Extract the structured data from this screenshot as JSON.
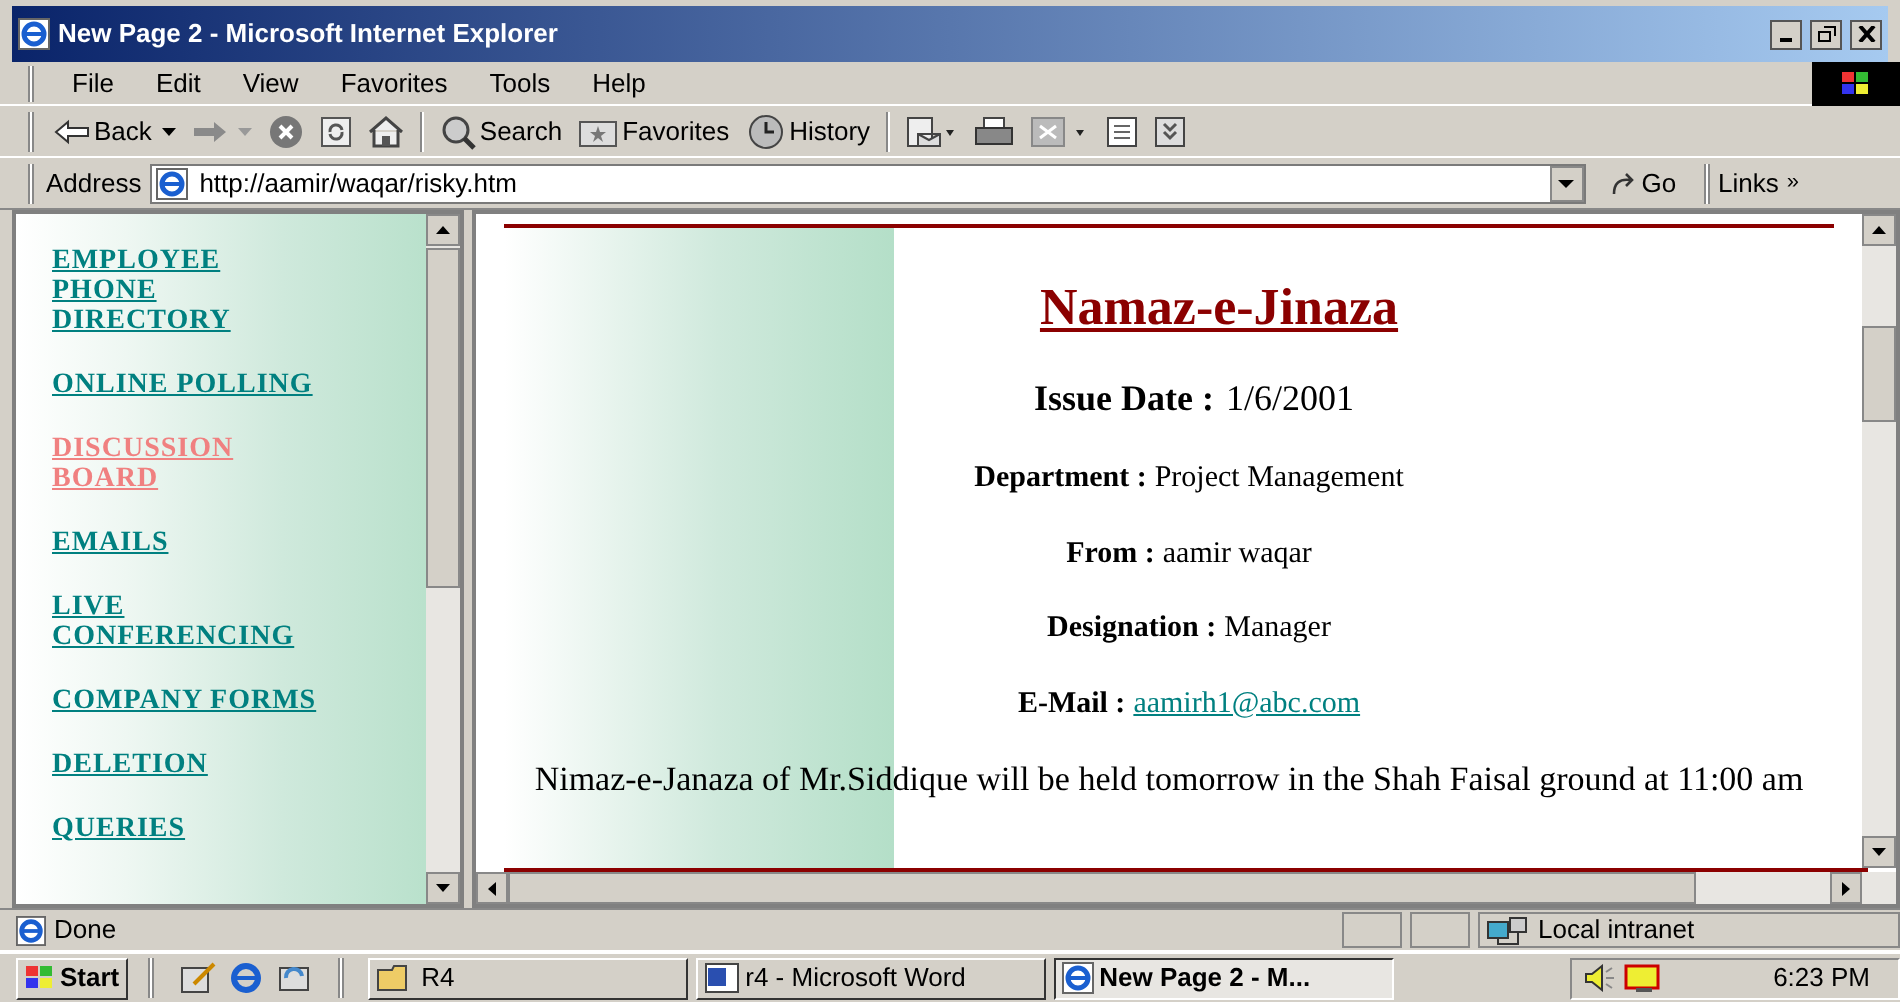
{
  "window": {
    "title": "New Page 2 - Microsoft Internet Explorer"
  },
  "menu": [
    "File",
    "Edit",
    "View",
    "Favorites",
    "Tools",
    "Help"
  ],
  "toolbar": [
    {
      "kind": "back",
      "label": "Back"
    },
    {
      "kind": "forward"
    },
    {
      "kind": "stop"
    },
    {
      "kind": "refresh"
    },
    {
      "kind": "home"
    },
    {
      "kind": "search",
      "label": "Search"
    },
    {
      "kind": "favorites",
      "label": "Favorites"
    },
    {
      "kind": "history",
      "label": "History"
    },
    {
      "kind": "mail"
    },
    {
      "kind": "print"
    },
    {
      "kind": "edit"
    },
    {
      "kind": "discuss"
    },
    {
      "kind": "messenger"
    }
  ],
  "address": {
    "label": "Address",
    "url": "http://aamir/waqar/risky.htm",
    "go": "Go",
    "links": "Links",
    "more": "»"
  },
  "sidebar": {
    "items": [
      {
        "lines": [
          "EMPLOYEE",
          "PHONE",
          "DIRECTORY"
        ],
        "visited": false
      },
      {
        "lines": [
          "ONLINE POLLING"
        ],
        "visited": false
      },
      {
        "lines": [
          "DISCUSSION",
          "BOARD"
        ],
        "visited": true
      },
      {
        "lines": [
          "EMAILS"
        ],
        "visited": false
      },
      {
        "lines": [
          "LIVE",
          "CONFERENCING"
        ],
        "visited": false
      },
      {
        "lines": [
          "COMPANY FORMS"
        ],
        "visited": false
      },
      {
        "lines": [
          "DELETION"
        ],
        "visited": false
      },
      {
        "lines": [
          "QUERIES"
        ],
        "visited": false
      }
    ]
  },
  "notice": {
    "heading": "Namaz-e-Jinaza",
    "issue_label": "Issue Date :",
    "issue_date": "1/6/2001",
    "fields": [
      {
        "label": "Department :",
        "value": "Project Management",
        "kind": "text"
      },
      {
        "label": "From :",
        "value": "aamir waqar",
        "kind": "text"
      },
      {
        "label": "Designation :",
        "value": "Manager",
        "kind": "text"
      },
      {
        "label": "E-Mail :",
        "value": "aamirh1@abc.com",
        "kind": "link"
      }
    ],
    "message": "Nimaz-e-Janaza of Mr.Siddique will be held tomorrow in the Shah Faisal ground at 11:00 am"
  },
  "status_bar": {
    "text": "Done",
    "zone": "Local intranet"
  },
  "taskbar": {
    "start": "Start",
    "tasks": [
      {
        "label": "R4",
        "kind": "folder",
        "selected": false
      },
      {
        "label": "r4 - Microsoft Word",
        "kind": "word",
        "selected": false
      },
      {
        "label": "New Page 2 - M...",
        "kind": "ie",
        "selected": true
      }
    ],
    "clock": "6:23 PM"
  }
}
